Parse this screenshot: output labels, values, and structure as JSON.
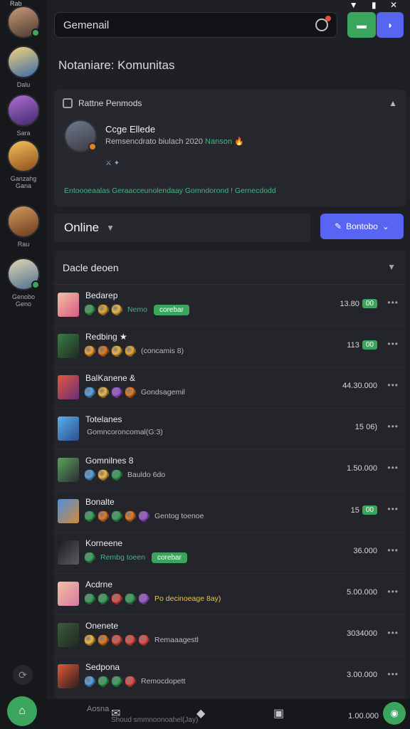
{
  "rail": {
    "top_label": "Rab",
    "items": [
      {
        "label": "",
        "gradient": "linear-gradient(160deg,#c99a7a,#4b3a2e)",
        "status": "#3ba55d"
      },
      {
        "label": "Dalu",
        "gradient": "linear-gradient(160deg,#f3d37a,#3d6aa8)",
        "status": ""
      },
      {
        "label": "Sara",
        "gradient": "linear-gradient(160deg,#b06cd6,#3e2a68)",
        "status": ""
      },
      {
        "label": "Ganzahg\nGana",
        "gradient": "linear-gradient(160deg,#f6c25a,#8b4d1a)",
        "status": ""
      },
      {
        "label": "Rau",
        "gradient": "linear-gradient(160deg,#d59a5e,#6a3a1e)",
        "status": ""
      },
      {
        "label": "Genobo\nGeno",
        "gradient": "linear-gradient(160deg,#e2d6b4,#4d6f8f)",
        "status": "#3ba55d"
      }
    ]
  },
  "topbar": {
    "search_text": "Gemenail",
    "status_icons": "▼ ▮ ✕"
  },
  "section_title": "Notaniare: Komunitas",
  "featured": {
    "header": "Rattne Penmods",
    "name": "Ccge Ellede",
    "subtitle": "Remsencdrato biulach 2020",
    "subtitle_green": "Nanson",
    "subtitle_emoji": "🔥",
    "icons": "⚔ ✦",
    "footer": "Entoooeaalas Geraacceunolendaay Gomndorond ! Gernecdodd"
  },
  "online_label": "Online",
  "primary_button_label": "Bontobo",
  "list": {
    "title": "Dacle deoen",
    "rows": [
      {
        "name": "Bedarep",
        "thumb": "linear-gradient(135deg,#f4c0a8,#d55b7d)",
        "orbs": [
          "#3ba55d",
          "#e6a93b",
          "#f0b845"
        ],
        "tag": "Nemo",
        "tag_class": "green",
        "pill": "corebar",
        "value": "13.80",
        "value_pill": "00"
      },
      {
        "name": "Redbing ★",
        "thumb": "linear-gradient(135deg,#3a7d44,#1d2a1f)",
        "orbs": [
          "#f0a33b",
          "#e07b2a",
          "#f0b845",
          "#e6a93b"
        ],
        "tag": "(concamis 8)",
        "tag_class": "",
        "pill": "",
        "value": "113",
        "value_pill": "00"
      },
      {
        "name": "BalKanene &",
        "thumb": "linear-gradient(135deg,#e05a3a,#6a2c7a)",
        "orbs": [
          "#5aa3e0",
          "#f0b845",
          "#a05ad6",
          "#e07b2a"
        ],
        "tag": "Gondsagemil",
        "tag_class": "",
        "pill": "",
        "value": "44.30.000",
        "value_pill": ""
      },
      {
        "name": "Totelanes",
        "thumb": "linear-gradient(135deg,#5ab0e8,#2a4f8f)",
        "orbs": [],
        "tag": "Gomncoroncomal(G:3)",
        "tag_class": "",
        "pill": "",
        "value": "15 06)",
        "value_pill": ""
      },
      {
        "name": "Gomnilnes 8",
        "thumb": "linear-gradient(135deg,#5aa35a,#2a2c33)",
        "orbs": [
          "#5aa3e0",
          "#f0b845",
          "#3ba55d"
        ],
        "tag": "Bauldo 6do",
        "tag_class": "",
        "pill": "",
        "value": "1.50.000",
        "value_pill": ""
      },
      {
        "name": "Bonalte",
        "thumb": "linear-gradient(135deg,#4a8fe0,#d58a3a)",
        "orbs": [
          "#3ba55d",
          "#e07b2a",
          "#3ba55d",
          "#e07b2a",
          "#a05ad6"
        ],
        "tag": "Gentog toenoe",
        "tag_class": "",
        "pill": "",
        "value": "15",
        "value_pill": "00"
      },
      {
        "name": "Korneene",
        "thumb": "linear-gradient(135deg,#1b1c20,#5a5c63)",
        "orbs": [
          "#3ba55d"
        ],
        "tag": "Rembg toeen",
        "tag_class": "green",
        "pill": "corebar",
        "value": "36.000",
        "value_pill": ""
      },
      {
        "name": "Acdrne",
        "thumb": "linear-gradient(135deg,#f4c0a8,#d57a9d)",
        "orbs": [
          "#3ba55d",
          "#3ba55d",
          "#e6534a",
          "#3ba55d",
          "#a05ad6"
        ],
        "tag": "Po decinoeage 8ay)",
        "tag_class": "yellow",
        "pill": "",
        "value": "5.00.000",
        "value_pill": ""
      },
      {
        "name": "Onenete",
        "thumb": "linear-gradient(135deg,#3d5a3d,#1d2a1f)",
        "orbs": [
          "#f0b845",
          "#e07b2a",
          "#e6534a",
          "#e6534a",
          "#e6534a"
        ],
        "tag": "Remaaagestl",
        "tag_class": "",
        "pill": "",
        "value": "3034000",
        "value_pill": ""
      },
      {
        "name": "Sedpona",
        "thumb": "linear-gradient(135deg,#e05a3a,#2a1d1a)",
        "orbs": [
          "#5aa3e0",
          "#3ba55d",
          "#3ba55d",
          "#e6534a"
        ],
        "tag": "Remocdopett",
        "tag_class": "",
        "pill": "",
        "value": "3.00.000",
        "value_pill": ""
      }
    ]
  },
  "bottombar": {
    "name": "Aosna",
    "sub": "Shoud smmnoonoahel(Jay)",
    "value": "1.00.000"
  },
  "icons": {
    "search": "search-icon",
    "notification": "notification-icon",
    "home": "home-icon"
  },
  "colors": {
    "accent_green": "#3ba55d",
    "accent_blue": "#5865f2",
    "background": "#1e2025"
  }
}
